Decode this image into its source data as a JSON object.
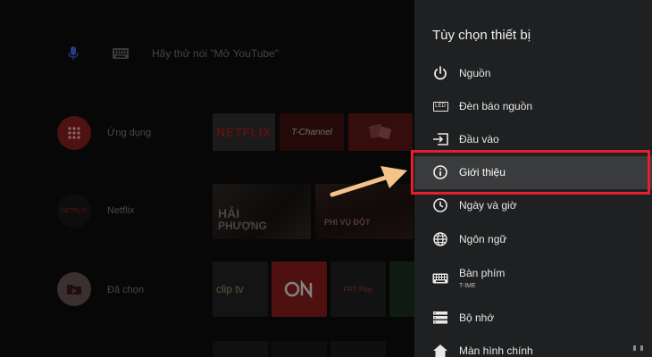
{
  "home": {
    "search_hint": "Hãy thử nói \"Mở YouTube\"",
    "rows": [
      {
        "label": "Ứng dụng",
        "icon": "apps-grid-icon"
      },
      {
        "label": "Netflix",
        "icon": "netflix-logo-icon",
        "logo_text": "NETFLIX"
      },
      {
        "label": "Đã chọn",
        "icon": "playlist-folder-icon"
      }
    ],
    "tiles": {
      "netflix_app": "NETFLIX",
      "tchannel_app": "T-Channel",
      "movie1_line1": "HẢI",
      "movie1_line2": "PHƯỢNG",
      "movie2": "PHI VỤ ĐỘT",
      "cliptv": "clip tv",
      "on_app": "ON",
      "fptplay_app": "FPT Play"
    }
  },
  "panel": {
    "title": "Tùy chọn thiết bị",
    "items": [
      {
        "label": "Nguồn",
        "icon": "power-icon"
      },
      {
        "label": "Đèn báo nguồn",
        "icon": "led-icon",
        "icon_text": "LED"
      },
      {
        "label": "Đầu vào",
        "icon": "input-icon"
      },
      {
        "label": "Giới thiệu",
        "icon": "info-icon",
        "focused": true
      },
      {
        "label": "Ngày và giờ",
        "icon": "clock-icon"
      },
      {
        "label": "Ngôn ngữ",
        "icon": "globe-icon"
      },
      {
        "label": "Bàn phím",
        "sublabel": "T-IME",
        "icon": "keyboard-icon"
      },
      {
        "label": "Bộ nhớ",
        "icon": "storage-icon"
      },
      {
        "label": "Màn hình chính",
        "icon": "home-icon"
      }
    ]
  },
  "colors": {
    "panel_bg": "#1f2021",
    "focus_bg": "#3a3b3c",
    "highlight": "#e5202a",
    "arrow": "#f4c38a",
    "netflix_red": "#e50914"
  }
}
